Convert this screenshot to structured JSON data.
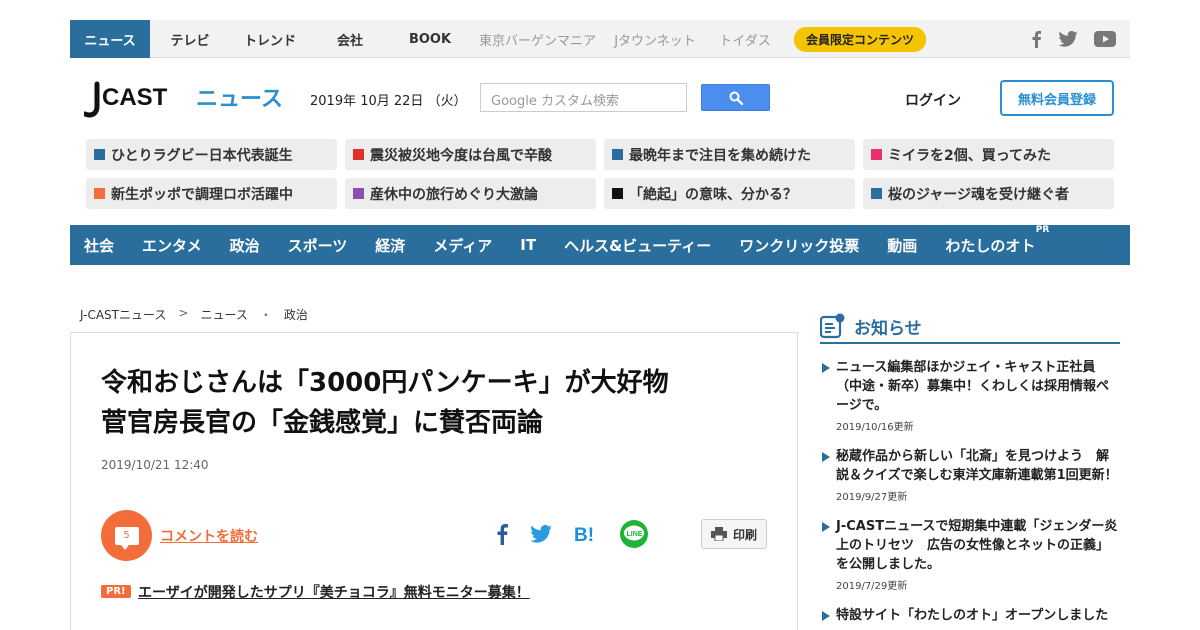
{
  "topnav": {
    "items": [
      {
        "label": "ニュース",
        "style": "active"
      },
      {
        "label": "テレビ",
        "style": "normal"
      },
      {
        "label": "トレンド",
        "style": "normal"
      },
      {
        "label": "会社",
        "style": "normal"
      },
      {
        "label": "BOOK",
        "style": "normal"
      },
      {
        "label": "東京バーゲンマニア",
        "style": "grey"
      },
      {
        "label": "Jタウンネット",
        "style": "grey"
      },
      {
        "label": "トイダス",
        "style": "grey"
      },
      {
        "label": "会員限定コンテンツ",
        "style": "pill"
      }
    ],
    "social_icons": [
      "facebook-icon",
      "twitter-icon",
      "youtube-icon"
    ]
  },
  "header": {
    "logo_text_1": "J",
    "logo_text_2": "CAST",
    "logo_text_3": "ニュース",
    "date": "2019年 10月 22日 （火）",
    "search_placeholder": "Google カスタム検索",
    "login": "ログイン",
    "register": "無料会員登録"
  },
  "tags": [
    {
      "label": "ひとりラグビー日本代表誕生",
      "color": "#2a6e9e"
    },
    {
      "label": "震災被災地今度は台風で辛酸",
      "color": "#e0302a"
    },
    {
      "label": "最晩年まで注目を集め続けた",
      "color": "#2a6e9e"
    },
    {
      "label": "ミイラを2個、買ってみた",
      "color": "#e8306a"
    },
    {
      "label": "新生ポッポで調理ロボ活躍中",
      "color": "#f36d3a"
    },
    {
      "label": "産休中の旅行めぐり大激論",
      "color": "#8a4fb0"
    },
    {
      "label": "「絶起」の意味、分かる？",
      "color": "#111111"
    },
    {
      "label": "桜のジャージ魂を受け継ぐ者",
      "color": "#2a6e9e"
    }
  ],
  "categories": [
    "社会",
    "エンタメ",
    "政治",
    "スポーツ",
    "経済",
    "メディア",
    "IT",
    "ヘルス&ビューティー",
    "ワンクリック投票",
    "動画",
    "わたしのオト"
  ],
  "category_pr": "PR",
  "breadcrumb": [
    "J-CASTニュース",
    ">",
    "ニュース",
    "・",
    "政治"
  ],
  "article": {
    "headline_1": "令和おじさんは「3000円パンケーキ」が大好物",
    "headline_2": "菅官房長官の「金銭感覚」に賛否両論",
    "date": "2019/10/21 12:40",
    "comment_count": "5",
    "comment_link": "コメントを読む",
    "print_label": "印刷",
    "pr_badge": "PR!",
    "pr_link": "エーザイが開発したサプリ『美チョコラ』無料モニター募集！"
  },
  "sidebar": {
    "title": "お知らせ",
    "notices": [
      {
        "text": "ニュース編集部ほかジェイ・キャスト正社員（中途・新卒）募集中！くわしくは採用情報ページで。",
        "updated": "2019/10/16更新"
      },
      {
        "text": "秘蔵作品から新しい「北斎」を見つけよう　解説＆クイズで楽しむ東洋文庫新連載第1回更新！",
        "updated": "2019/9/27更新"
      },
      {
        "text": "J-CASTニュースで短期集中連載「ジェンダー炎上のトリセツ　広告の女性像とネットの正義」を公開しました。",
        "updated": "2019/7/29更新"
      },
      {
        "text": "特設サイト「わたしのオト」オープンしました",
        "updated": ""
      }
    ]
  }
}
